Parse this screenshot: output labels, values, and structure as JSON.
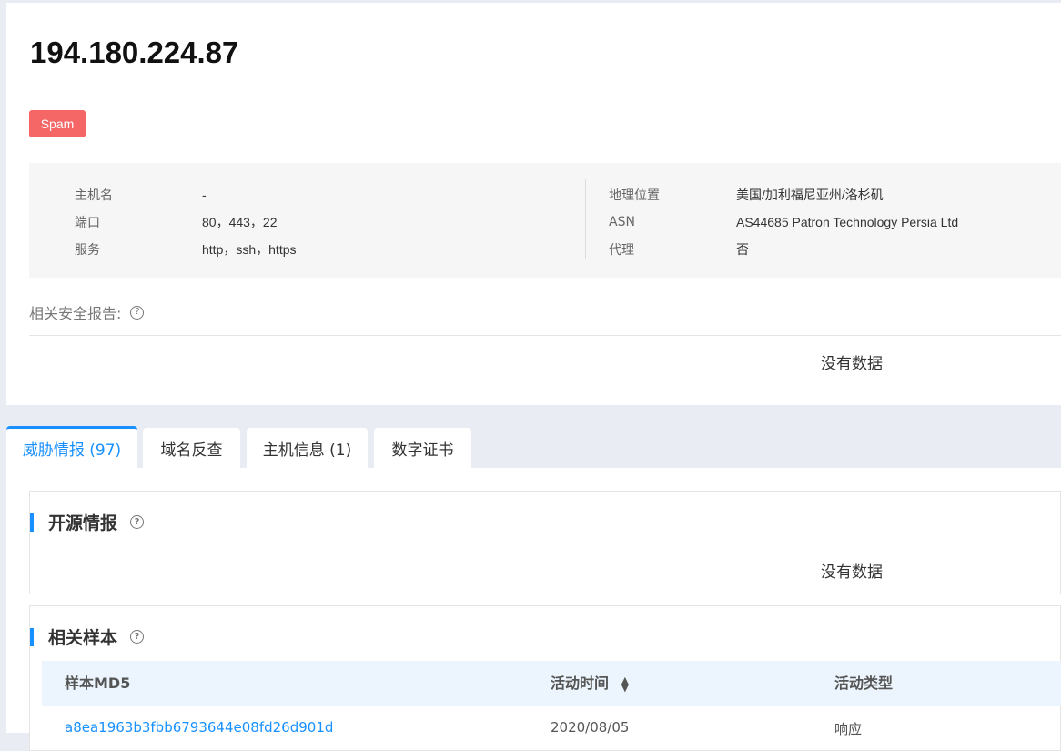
{
  "header": {
    "ip": "194.180.224.87",
    "tag": "Spam",
    "tag_color": "#f56766"
  },
  "info": {
    "left": [
      {
        "key": "主机名",
        "value": "-"
      },
      {
        "key": "端口",
        "value": "80，443，22"
      },
      {
        "key": "服务",
        "value": "http，ssh，https"
      }
    ],
    "right": [
      {
        "key": "地理位置",
        "value": "美国/加利福尼亚州/洛杉矶"
      },
      {
        "key": "ASN",
        "value": "AS44685 Patron Technology Persia Ltd"
      },
      {
        "key": "代理",
        "value": "否"
      }
    ]
  },
  "reports": {
    "label": "相关安全报告:",
    "help_icon": "question-circle-icon",
    "empty": "没有数据"
  },
  "tabs": [
    {
      "label": "威胁情报 (97)",
      "active": true
    },
    {
      "label": "域名反查",
      "active": false
    },
    {
      "label": "主机信息 (1)",
      "active": false
    },
    {
      "label": "数字证书",
      "active": false
    }
  ],
  "open_source": {
    "title": "开源情报",
    "empty": "没有数据"
  },
  "samples": {
    "title": "相关样本",
    "columns": [
      "样本MD5",
      "活动时间",
      "活动类型"
    ],
    "sort_icon": "sort-caret-icon",
    "rows": [
      [
        "a8ea1963b3fbb6793644e08fd26d901d",
        "2020/08/05",
        "响应"
      ]
    ]
  },
  "colors": {
    "accent": "#1890ff",
    "page_bg": "#e9ecf3",
    "panel_bg": "#f6f6f6",
    "table_head_bg": "#ecf5fd"
  }
}
